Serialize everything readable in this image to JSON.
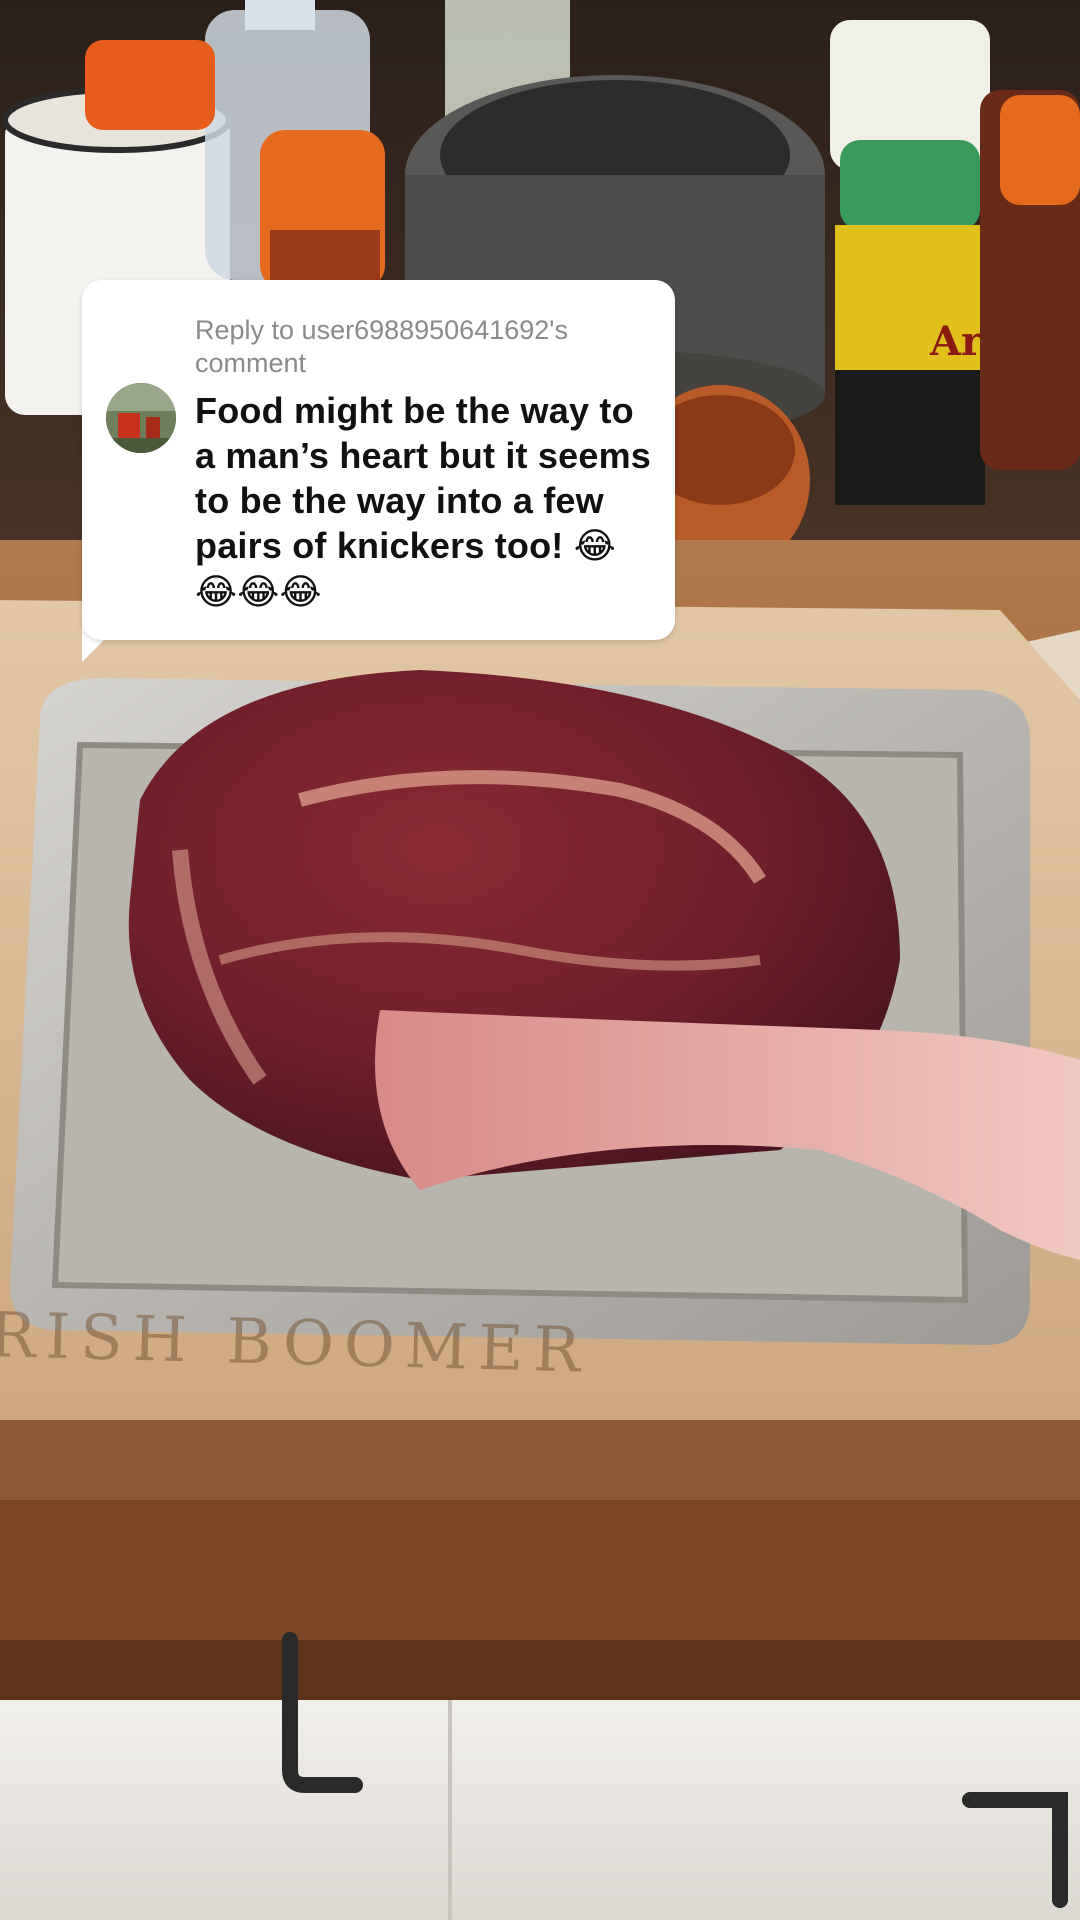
{
  "reply_bubble": {
    "reply_prefix": "Reply to user6988950641692's comment",
    "comment_text": "Food might be the way to a man’s heart but it seems to be the way into a few pairs of knickers too!",
    "emojis": "😂😂😂😂"
  },
  "board_engraving": {
    "text": "RISH BOOMER"
  },
  "colors": {
    "bubble_bg": "#ffffff",
    "reply_text": "#8a8a8a",
    "comment_text": "#111111"
  }
}
